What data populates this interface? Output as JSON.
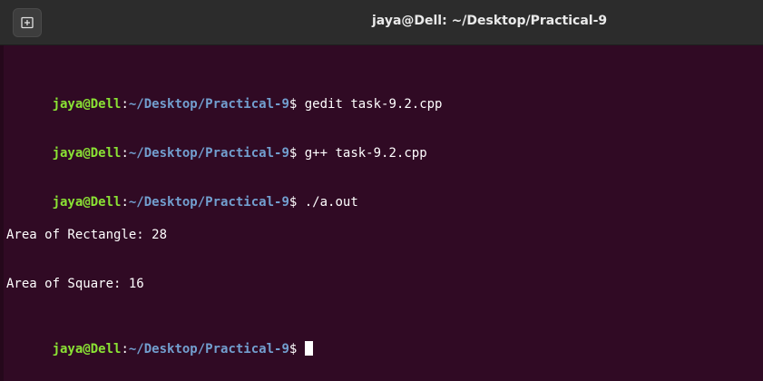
{
  "window": {
    "title": "jaya@Dell: ~/Desktop/Practical-9",
    "new_tab_icon": "new-tab-icon"
  },
  "prompt": {
    "user_host": "jaya@Dell",
    "colon": ":",
    "path": "~/Desktop/Practical-9",
    "symbol": "$"
  },
  "terminal": {
    "lines": [
      {
        "type": "command",
        "command": " gedit task-9.2.cpp"
      },
      {
        "type": "command",
        "command": " g++ task-9.2.cpp"
      },
      {
        "type": "command",
        "command": " ./a.out"
      },
      {
        "type": "output",
        "text": "Area of Rectangle: 28"
      },
      {
        "type": "output",
        "text": "Area of Square: 16"
      },
      {
        "type": "command",
        "command": " "
      }
    ]
  },
  "colors": {
    "background": "#300a24",
    "prompt_user": "#8ae234",
    "prompt_path": "#729fcf",
    "text": "#ffffff"
  }
}
